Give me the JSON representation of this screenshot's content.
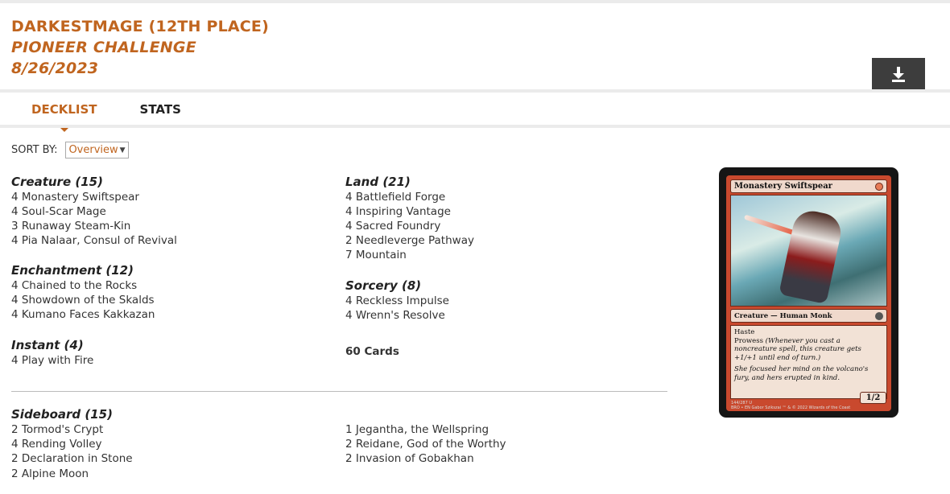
{
  "header": {
    "player": "DARKESTMAGE (12TH PLACE)",
    "event": "PIONEER CHALLENGE",
    "date": "8/26/2023",
    "download_icon": "download-icon"
  },
  "tabs": [
    {
      "label": "DECKLIST",
      "active": true
    },
    {
      "label": "STATS",
      "active": false
    }
  ],
  "sort": {
    "label": "SORT BY:",
    "selected": "Overview"
  },
  "colors": {
    "accent": "#c0651f",
    "button_bg": "#3d3d3d"
  },
  "deck": {
    "left": [
      {
        "title": "Creature (15)",
        "cards": [
          "4 Monastery Swiftspear",
          "4 Soul-Scar Mage",
          "3 Runaway Steam-Kin",
          "4 Pia Nalaar, Consul of Revival"
        ]
      },
      {
        "title": "Enchantment (12)",
        "cards": [
          "4 Chained to the Rocks",
          "4 Showdown of the Skalds",
          "4 Kumano Faces Kakkazan"
        ]
      },
      {
        "title": "Instant (4)",
        "cards": [
          "4 Play with Fire"
        ]
      }
    ],
    "right": [
      {
        "title": "Land (21)",
        "cards": [
          "4 Battlefield Forge",
          "4 Inspiring Vantage",
          "4 Sacred Foundry",
          "2 Needleverge Pathway",
          "7 Mountain"
        ]
      },
      {
        "title": "Sorcery (8)",
        "cards": [
          "4 Reckless Impulse",
          "4 Wrenn's Resolve"
        ]
      }
    ],
    "total": "60 Cards",
    "sideboard": {
      "title": "Sideboard (15)",
      "left": [
        "2 Tormod's Crypt",
        "4 Rending Volley",
        "2 Declaration in Stone",
        "2 Alpine Moon"
      ],
      "right": [
        "1 Jegantha, the Wellspring",
        "2 Reidane, God of the Worthy",
        "2 Invasion of Gobakhan"
      ]
    }
  },
  "card_preview": {
    "name": "Monastery Swiftspear",
    "type_line": "Creature — Human Monk",
    "ability1": "Haste",
    "ability2_name": "Prowess",
    "ability2_reminder": "(Whenever you cast a noncreature spell, this creature gets +1/+1 until end of turn.)",
    "flavor": "She focused her mind on the volcano's fury, and hers erupted in kind.",
    "pt": "1/2",
    "collector": "144/287 U",
    "set_line": "BRO • EN",
    "artist": "Gabor Szikszai",
    "copyright": "™ & © 2022 Wizards of the Coast"
  }
}
